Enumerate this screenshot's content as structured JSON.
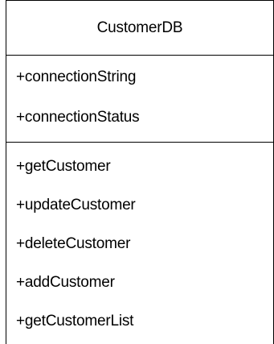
{
  "class_diagram": {
    "class_name": "CustomerDB",
    "attributes": [
      "+connectionString",
      "+connectionStatus"
    ],
    "operations": [
      "+getCustomer",
      "+updateCustomer",
      "+deleteCustomer",
      "+addCustomer",
      "+getCustomerList"
    ]
  }
}
